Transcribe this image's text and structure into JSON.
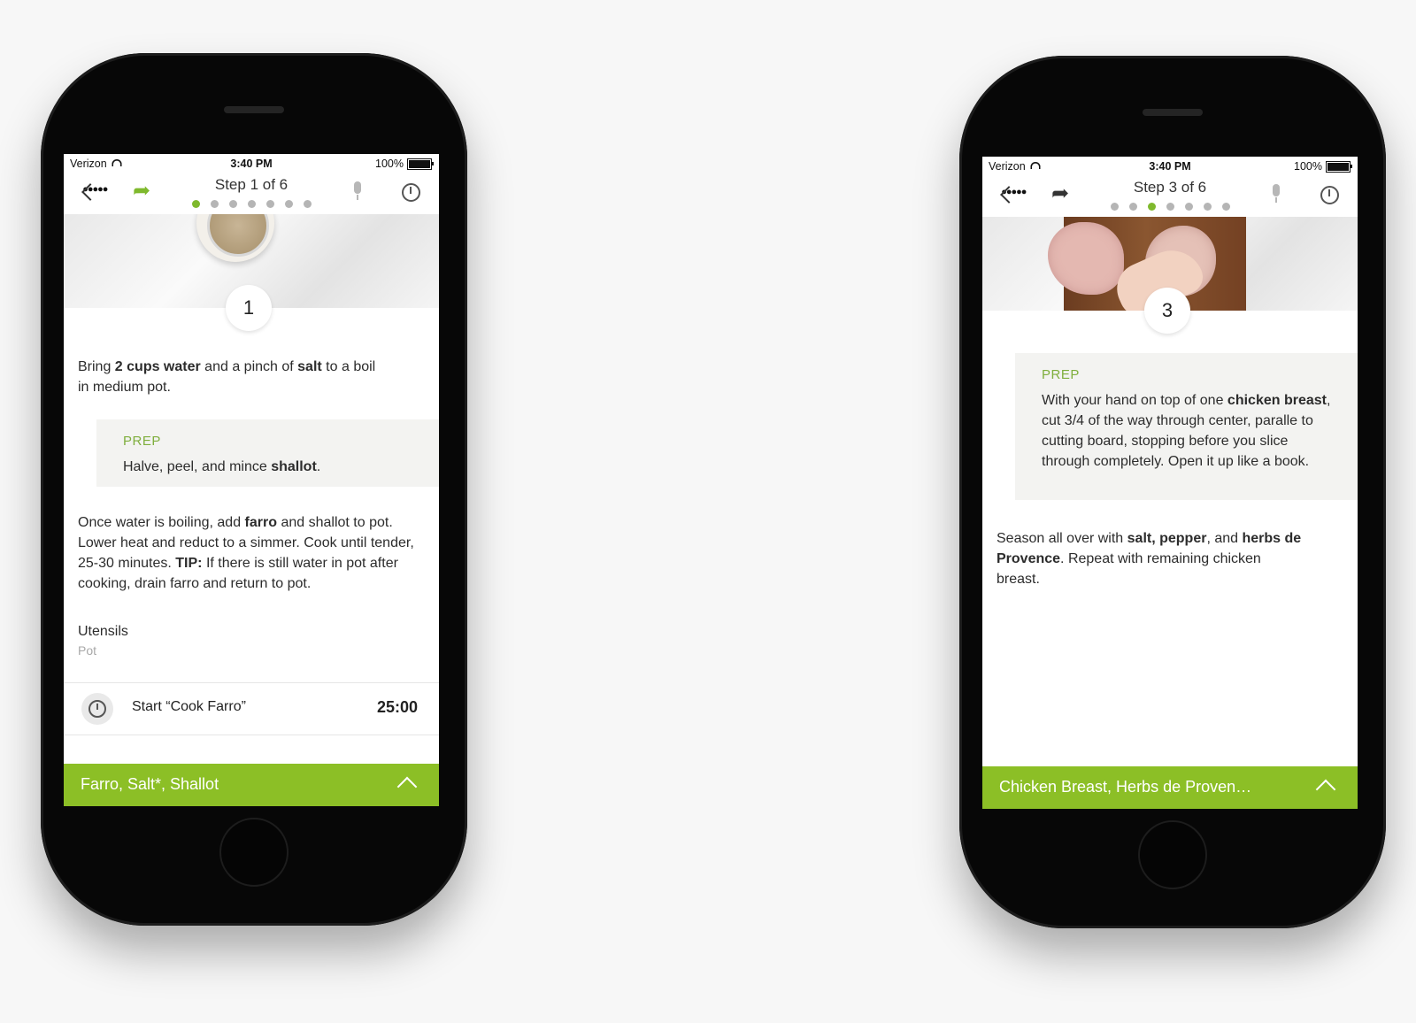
{
  "left": {
    "status": {
      "carrier": "Verizon",
      "signal": "●●●●●",
      "time": "3:40 PM",
      "battery": "100%"
    },
    "nav": {
      "title": "Step 1 of 6",
      "dots": 7,
      "active_dot": 0,
      "back_icon": "chevron-left-icon",
      "share_icon": "share-arrow-icon",
      "share_color": "#7fb92d",
      "mic_icon": "microphone-icon",
      "timer_icon": "stopwatch-icon"
    },
    "step_number": "1",
    "intro": {
      "p1": "Bring ",
      "b1": "2 cups water",
      "p2": " and a pinch of ",
      "b2": "salt",
      "p3": " to a boil in medium pot."
    },
    "prep": {
      "label": "PREP",
      "p1": "Halve, peel, and mince ",
      "b1": "shallot",
      "p2": "."
    },
    "body": {
      "p1": "Once water is boiling, add ",
      "b1": "farro",
      "p2": " and shallot to pot. Lower heat and reduct to a simmer. Cook until tender, 25-30 minutes. ",
      "b2": "TIP:",
      "p3": " If there is still water in pot after cooking, drain farro and return to pot."
    },
    "utensils": {
      "label": "Utensils",
      "value": "Pot"
    },
    "timer": {
      "label": "Start “Cook Farro”",
      "value": "25:00"
    },
    "ingredients": "Farro, Salt*, Shallot"
  },
  "right": {
    "status": {
      "carrier": "Verizon",
      "signal": "●●●●●",
      "time": "3:40 PM",
      "battery": "100%"
    },
    "nav": {
      "title": "Step 3 of 6",
      "dots": 7,
      "active_dot": 2,
      "back_icon": "chevron-left-icon",
      "share_icon": "share-arrow-icon",
      "share_color": "#333333",
      "mic_icon": "microphone-icon",
      "timer_icon": "stopwatch-icon"
    },
    "step_number": "3",
    "prep": {
      "label": "PREP",
      "p1": "With your hand on top of one ",
      "b1": "chicken breast",
      "p2": ", cut 3/4 of the way through center, paralle to cutting board, stopping before you slice through completely. Open it up like a book."
    },
    "body": {
      "p1": "Season all over with ",
      "b1": "salt, pepper",
      "p2": ", and ",
      "b2": "herbs de Provence",
      "p3": ". Repeat with remaining chicken breast."
    },
    "ingredients": "Chicken Breast, Herbs de Proven…"
  },
  "colors": {
    "accent_green": "#8cbf26",
    "prep_label_green": "#7fae3d",
    "prep_bg": "#f3f3f1"
  }
}
